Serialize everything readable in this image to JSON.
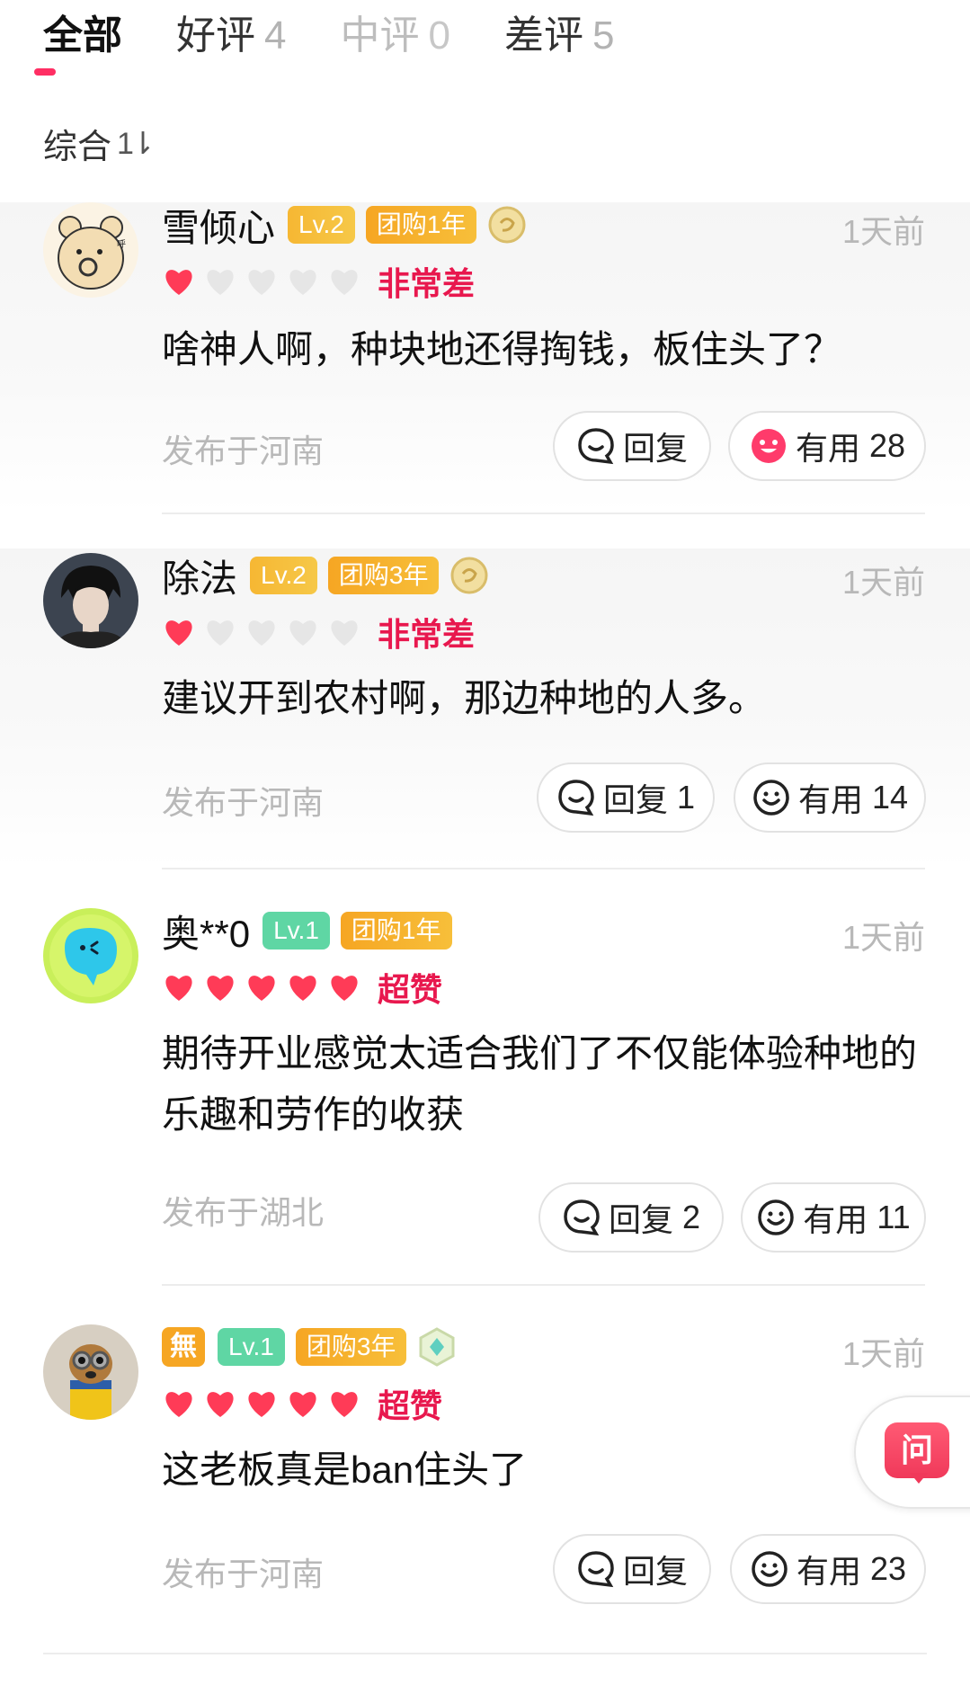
{
  "tabs": [
    {
      "label": "全部",
      "count": ""
    },
    {
      "label": "好评",
      "count": "4"
    },
    {
      "label": "中评",
      "count": "0"
    },
    {
      "label": "差评",
      "count": "5"
    }
  ],
  "sort": {
    "label": "综合",
    "icon": "sort-arrows-icon"
  },
  "colors": {
    "accent": "#ff2e63",
    "rating_text": "#e8184e",
    "heart_full": "#ff3b57",
    "heart_empty": "#e6e6e6",
    "level_badge": "#f6b733",
    "level1_badge": "#5fd6a4",
    "group_badge": "#f6a623"
  },
  "reviews": [
    {
      "user": "雪倾心",
      "level": "Lv.2",
      "group": "团购1年",
      "time": "1天前",
      "stars": 1,
      "rating_text": "非常差",
      "comment": "啥神人啊，种块地还得掏钱，板住头了？",
      "location": "发布于河南",
      "reply_label": "回复",
      "reply_count": "",
      "useful_label": "有用",
      "useful_count": "28"
    },
    {
      "user": "除法",
      "level": "Lv.2",
      "group": "团购3年",
      "time": "1天前",
      "stars": 1,
      "rating_text": "非常差",
      "comment": "建议开到农村啊，那边种地的人多。",
      "location": "发布于河南",
      "reply_label": "回复",
      "reply_count": "1",
      "useful_label": "有用",
      "useful_count": "14"
    },
    {
      "user": "奥**0",
      "level": "Lv.1",
      "group": "团购1年",
      "time": "1天前",
      "stars": 5,
      "rating_text": "超赞",
      "comment": "期待开业感觉太适合我们了不仅能体验种地的乐趣和劳作的收获",
      "location": "发布于湖北",
      "reply_label": "回复",
      "reply_count": "2",
      "useful_label": "有用",
      "useful_count": "11"
    },
    {
      "user": "無",
      "level": "Lv.1",
      "group": "团购3年",
      "time": "1天前",
      "stars": 5,
      "rating_text": "超赞",
      "comment": "这老板真是ban住头了",
      "location": "发布于河南",
      "reply_label": "回复",
      "reply_count": "",
      "useful_label": "有用",
      "useful_count": "23"
    }
  ],
  "float_button": {
    "label": "问"
  }
}
